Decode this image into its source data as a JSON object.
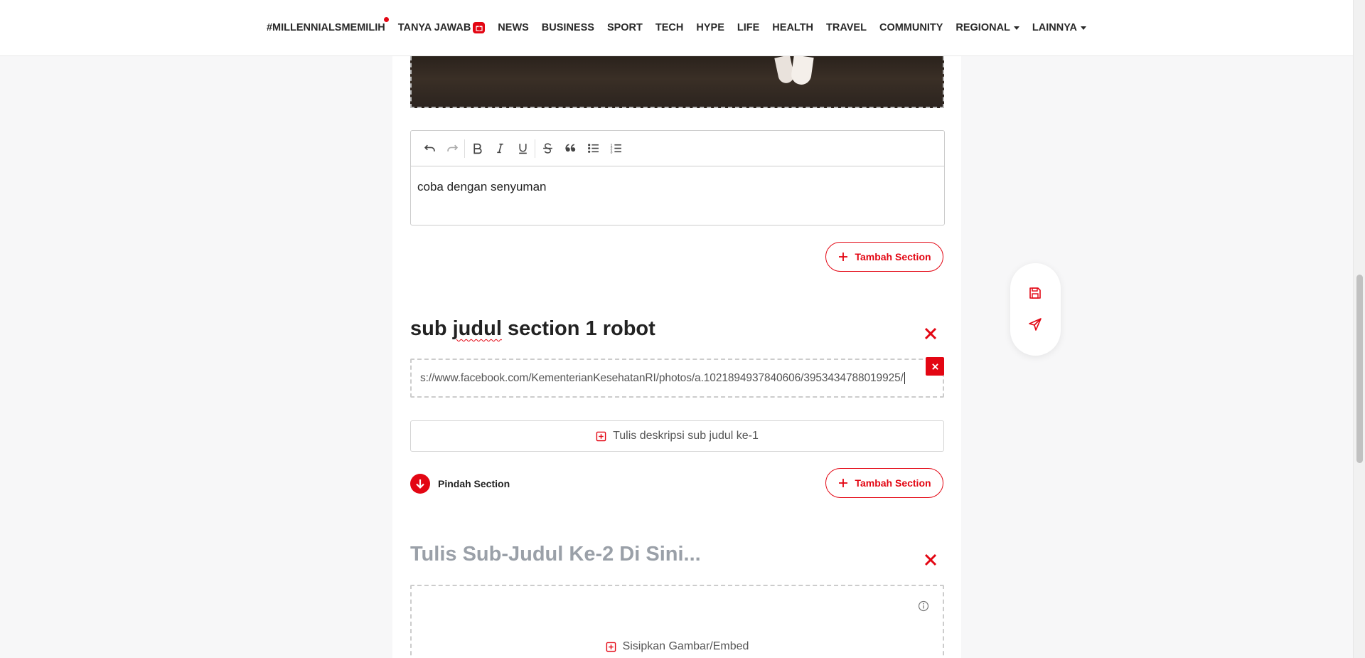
{
  "nav": {
    "items": [
      {
        "label": "#MILLENNIALSMEMILIH",
        "dot": true
      },
      {
        "label": "TANYA JAWAB",
        "badge": "gift-icon"
      },
      {
        "label": "NEWS"
      },
      {
        "label": "BUSINESS"
      },
      {
        "label": "SPORT"
      },
      {
        "label": "TECH"
      },
      {
        "label": "HYPE"
      },
      {
        "label": "LIFE"
      },
      {
        "label": "HEALTH"
      },
      {
        "label": "TRAVEL"
      },
      {
        "label": "COMMUNITY"
      },
      {
        "label": "REGIONAL",
        "dropdown": true
      },
      {
        "label": "LAINNYA",
        "dropdown": true
      }
    ]
  },
  "editor": {
    "text_content": "coba dengan senyuman",
    "toolbar": [
      "undo-icon",
      "redo-icon",
      "bold-icon",
      "italic-icon",
      "underline-icon",
      "strikethrough-icon",
      "quote-icon",
      "bulleted-list-icon",
      "numbered-list-icon"
    ]
  },
  "section1": {
    "add_section_label": "Tambah Section",
    "title_part1": "sub ",
    "title_misspelled": "judul",
    "title_part2": " section 1 robot",
    "embed_url": "s://www.facebook.com/KementerianKesehatanRI/photos/a.1021894937840606/3953434788019925/",
    "description_placeholder": "Tulis deskripsi sub judul ke-1",
    "move_label": "Pindah Section",
    "add_section_label_2": "Tambah Section"
  },
  "section2": {
    "title_placeholder": "Tulis Sub-Judul Ke-2 Di Sini...",
    "insert_label": "Sisipkan Gambar/Embed"
  },
  "floating": {
    "actions": [
      "save-icon",
      "send-icon"
    ]
  },
  "colors": {
    "accent": "#e30613",
    "text": "#222222",
    "placeholder": "#9aa0a8"
  }
}
